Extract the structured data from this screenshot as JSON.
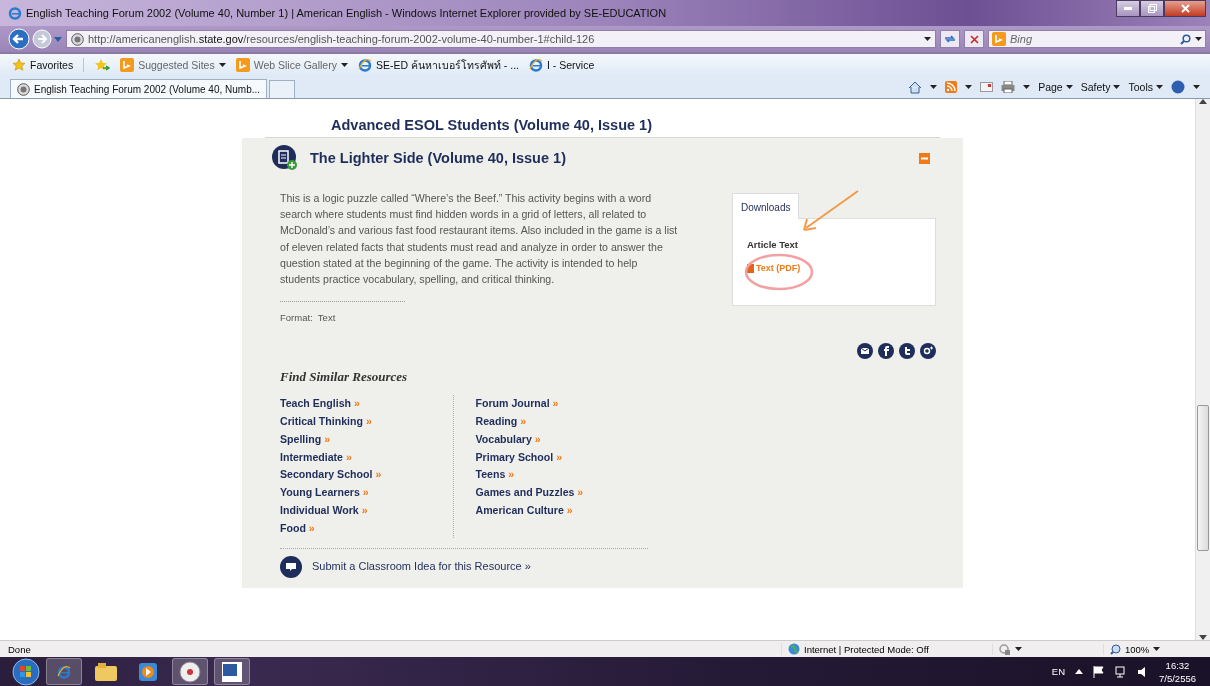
{
  "window": {
    "title": "English Teaching Forum 2002 (Volume 40, Number 1) | American English - Windows Internet Explorer provided by SE-EDUCATION"
  },
  "address_bar": {
    "url": "http://americanenglish.**state.gov**/resources/english-teaching-forum-2002-volume-40-number-1#child-126"
  },
  "search": {
    "placeholder": "Bing"
  },
  "favorites_bar": [
    {
      "label": "Favorites",
      "kind": "star"
    },
    {
      "label": "Suggested Sites",
      "kind": "dropdown"
    },
    {
      "label": "Web Slice Gallery",
      "kind": "dropdown"
    },
    {
      "label": "SE-ED ค้นหาเบอร์โทรศัพท์ - ...",
      "kind": "page"
    },
    {
      "label": "I - Service",
      "kind": "page"
    }
  ],
  "tabs": [
    {
      "label": "English Teaching Forum 2002 (Volume 40, Numb...",
      "selected": true
    }
  ],
  "command_bar": [
    "Page",
    "Safety",
    "Tools"
  ],
  "page": {
    "previous_item_title": "Advanced ESOL Students (Volume 40, Issue 1)",
    "item": {
      "title": "The Lighter Side (Volume 40, Issue 1)",
      "expanded": true,
      "description": "This is a logic puzzle called “Where’s the Beef.” This activity begins with a word search where students must find hidden words in a grid of letters, all related to McDonald’s and various fast food restaurant items. Also included in the game is a list of eleven related facts that students must read and analyze in order to answer the question stated at the beginning of the game. The activity is intended to help students practice vocabulary, spelling, and critical thinking.",
      "format_label": "Format:",
      "format_value": "Text",
      "downloads": {
        "tab": "Downloads",
        "heading": "Article Text",
        "link": "Text (PDF)"
      }
    },
    "similar": {
      "heading": "Find Similar Resources",
      "columns": [
        [
          {
            "label": "Teach English",
            "arrow": "»"
          },
          {
            "label": "Critical Thinking",
            "arrow": "»"
          },
          {
            "label": "Spelling",
            "arrow": "»"
          },
          {
            "label": "Intermediate",
            "arrow": "»"
          },
          {
            "label": "Secondary School",
            "arrow": "»"
          },
          {
            "label": "Young Learners",
            "arrow": "»"
          },
          {
            "label": "Individual Work",
            "arrow": "»"
          },
          {
            "label": "Food",
            "arrow": "»"
          }
        ],
        [
          {
            "label": "Forum Journal",
            "arrow": "»"
          },
          {
            "label": "Reading",
            "arrow": "»"
          },
          {
            "label": "Vocabulary",
            "arrow": "»"
          },
          {
            "label": "Primary School",
            "arrow": "»"
          },
          {
            "label": "Teens",
            "arrow": "»"
          },
          {
            "label": "Games and Puzzles",
            "arrow": "»"
          },
          {
            "label": "American Culture",
            "arrow": "»"
          }
        ]
      ]
    },
    "submit": {
      "label": "Submit a Classroom Idea for this Resource",
      "arrow": "»"
    }
  },
  "status_bar": {
    "status": "Done",
    "zone": "Internet | Protected Mode: Off",
    "zoom": "100%"
  },
  "taskbar": {
    "language": "EN",
    "time": "16:32",
    "date": "7/5/2556"
  }
}
